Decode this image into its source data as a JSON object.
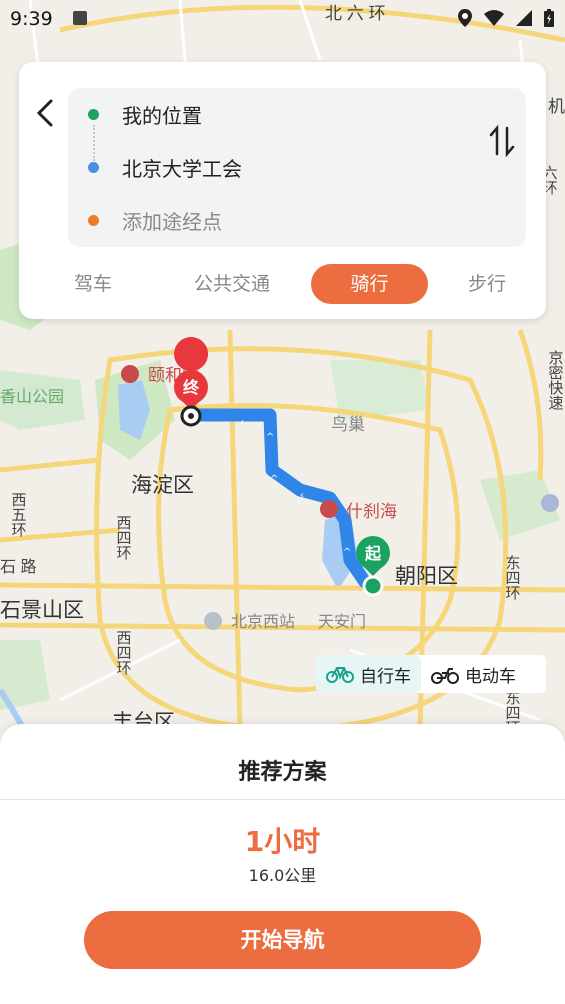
{
  "status": {
    "time": "9:39"
  },
  "route_card": {
    "origin": "我的位置",
    "destination": "北京大学工会",
    "add_stop_placeholder": "添加途经点",
    "origin_color": "#1aa260",
    "destination_color": "#4a90e2",
    "add_stop_color": "#f07b2b"
  },
  "tabs": [
    {
      "label": "驾车",
      "active": false
    },
    {
      "label": "公共交通",
      "active": false
    },
    {
      "label": "骑行",
      "active": true
    },
    {
      "label": "步行",
      "active": false
    }
  ],
  "vehicles": [
    {
      "label": "自行车",
      "active": true
    },
    {
      "label": "电动车",
      "active": false
    }
  ],
  "map": {
    "labels": {
      "north_ring": "北 六 环",
      "yiheyuan": "颐和园",
      "xiangshan": "香山公园",
      "haidian": "海淀区",
      "xiwuhuan": "西五环",
      "xisihuan": "西四环",
      "shijingshan": "石景山区",
      "shilu": "石 路",
      "birdnest": "鸟巢",
      "shichahai": "什刹海",
      "chaoyang": "朝阳区",
      "dongsihuan": "东四环",
      "beijingwest": "北京西站",
      "tiananmen": "天安门",
      "fengtai": "丰台区",
      "jingmi": "京密快速",
      "liuhuan_right": "六环",
      "jichang": "机"
    },
    "end_marker": "终",
    "start_marker": "起",
    "route_color": "#2f86e8"
  },
  "sheet": {
    "title": "推荐方案",
    "duration": "1小时",
    "distance": "16.0公里",
    "start_button": "开始导航"
  }
}
